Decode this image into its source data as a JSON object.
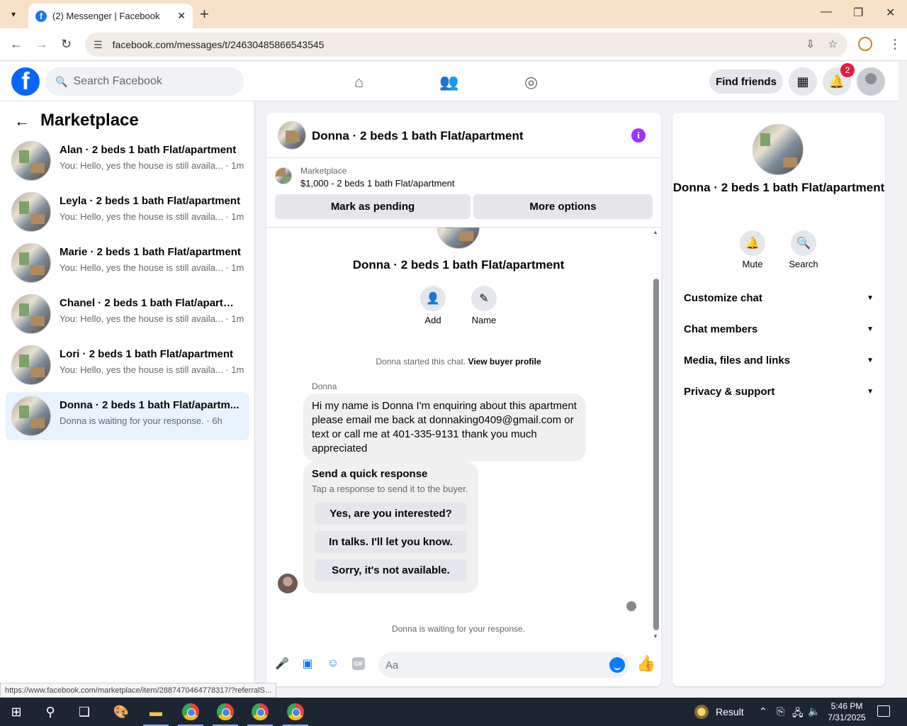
{
  "browser": {
    "tab_title": "(2) Messenger | Facebook",
    "url": "facebook.com/messages/t/24630485866543545",
    "status_url": "https://www.facebook.com/marketplace/item/2887470464778317/?referralS..."
  },
  "fb_header": {
    "search_placeholder": "Search Facebook",
    "find_friends": "Find friends",
    "notification_count": "2"
  },
  "left": {
    "title": "Marketplace",
    "conversations": [
      {
        "name": "Alan · 2 beds 1 bath Flat/apartment",
        "preview": "You: Hello, yes the house is still availa... · 1m"
      },
      {
        "name": "Leyla · 2 beds 1 bath Flat/apartment",
        "preview": "You: Hello, yes the house is still availa... · 1m"
      },
      {
        "name": "Marie · 2 beds 1 bath Flat/apartment",
        "preview": "You: Hello, yes the house is still availa... · 1m"
      },
      {
        "name": "Chanel · 2 beds 1 bath Flat/apartm...",
        "preview": "You: Hello, yes the house is still availa... · 1m"
      },
      {
        "name": "Lori · 2 beds 1 bath Flat/apartment",
        "preview": "You: Hello, yes the house is still availa... · 1m"
      },
      {
        "name": "Donna · 2 beds 1 bath Flat/apartm...",
        "preview": "Donna is waiting for your response. · 6h"
      }
    ]
  },
  "chat": {
    "header_title": "Donna · 2 beds 1 bath Flat/apartment",
    "marketplace_label": "Marketplace",
    "listing": "$1,000 - 2 beds 1 bath Flat/apartment",
    "mark_pending": "Mark as pending",
    "more_options": "More options",
    "conv_title": "Donna · 2 beds 1 bath Flat/apartment",
    "add_label": "Add",
    "name_label": "Name",
    "started_text": "Donna started this chat.",
    "view_profile": "View buyer profile",
    "sender": "Donna",
    "message": "Hi my name is Donna I'm enquiring about this apartment please email me back at donnaking0409@gmail.com or text or call me at 401-335-9131 thank you much appreciated",
    "quick_title": "Send a quick response",
    "quick_sub": "Tap a response to send it to the buyer.",
    "quick_replies": [
      "Yes, are you interested?",
      "In talks. I'll let you know.",
      "Sorry, it's not available."
    ],
    "waiting": "Donna is waiting for your response.",
    "input_placeholder": "Aa"
  },
  "right": {
    "title": "Donna · 2 beds 1 bath Flat/apartment",
    "mute": "Mute",
    "search": "Search",
    "sections": [
      "Customize chat",
      "Chat members",
      "Media, files and links",
      "Privacy & support"
    ]
  },
  "taskbar": {
    "result": "Result",
    "time": "5:46 PM",
    "date": "7/31/2025"
  },
  "colors": {
    "brand": "#0866ff",
    "accent_purple": "#a033ff",
    "active_row": "#e7f3ff",
    "badge": "#e41e3f"
  }
}
